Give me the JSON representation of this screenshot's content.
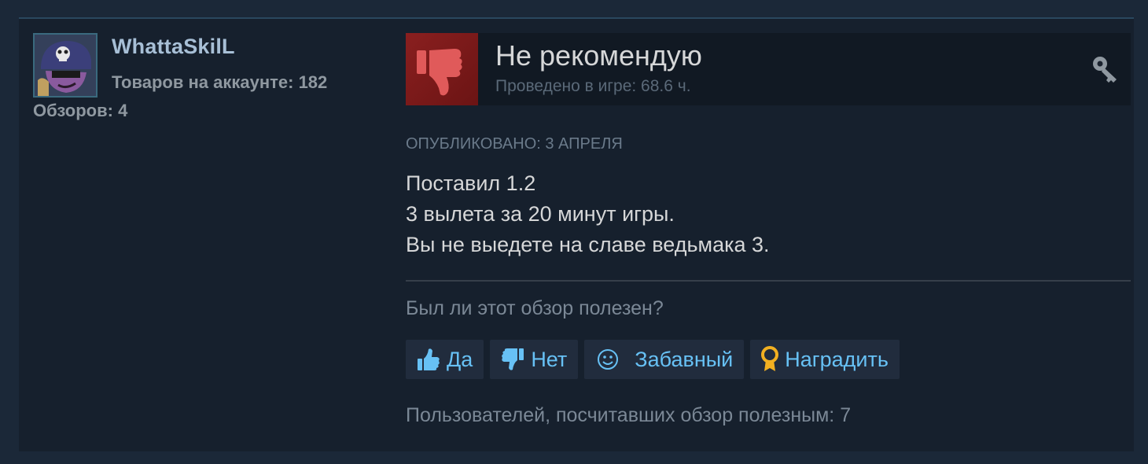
{
  "author": {
    "username": "WhattaSkilL",
    "products_line": "Товаров на аккаунте: 182",
    "reviews_line": "Обзоров: 4"
  },
  "review": {
    "verdict": "Не рекомендую",
    "playtime": "Проведено в игре: 68.6 ч.",
    "posted": "Опубликовано: 3 апреля",
    "lines": [
      "Поставил 1.2",
      "3 вылета за 20 минут игры.",
      "Вы не выедете на славе ведьмака 3."
    ],
    "helpful_question": "Был ли этот обзор полезен?",
    "buttons": {
      "yes": "Да",
      "no": "Нет",
      "funny": "Забавный",
      "award": "Наградить"
    },
    "helpful_count": "Пользователей, посчитавших обзор полезным: 7"
  },
  "colors": {
    "background": "#1b2838",
    "card": "#16202d",
    "accent_link": "#67c1f5",
    "thumb_down_bg": "#8a1f1f",
    "award_gold": "#f2b021"
  },
  "icons": {
    "avatar": "skull-cap-character",
    "verdict": "thumbs-down-icon",
    "key": "key-icon",
    "yes": "thumbs-up-icon",
    "no": "thumbs-down-icon",
    "funny": "smiley-icon",
    "award": "medal-icon"
  }
}
